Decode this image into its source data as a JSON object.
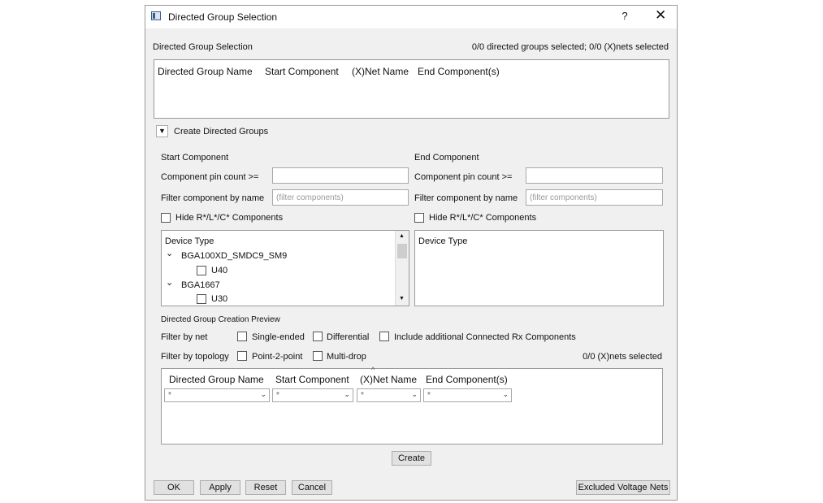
{
  "window": {
    "title": "Directed Group Selection",
    "help": "?",
    "close": "✕"
  },
  "selection": {
    "section_label": "Directed Group Selection",
    "status": "0/0 directed groups selected; 0/0 (X)nets selected",
    "columns": [
      "Directed Group Name",
      "Start Component",
      "(X)Net Name",
      "End Component(s)"
    ]
  },
  "create_section": {
    "toggle_glyph": "▼",
    "label": "Create Directed Groups"
  },
  "start": {
    "heading": "Start Component",
    "pin_count_label": "Component pin count >=",
    "pin_count_value": "",
    "filter_label": "Filter component by name",
    "filter_placeholder": "(filter components)",
    "hide_label": "Hide R*/L*/C* Components",
    "device_header": "Device Type",
    "tree": [
      {
        "label": "BGA100XD_SMDC9_SM9",
        "expander": "⌄",
        "child": "U40"
      },
      {
        "label": "BGA1667",
        "expander": "⌄",
        "child": "U30"
      }
    ],
    "scroll_up": "▲",
    "scroll_down": "▼"
  },
  "end": {
    "heading": "End Component",
    "pin_count_label": "Component pin count >=",
    "pin_count_value": "",
    "filter_label": "Filter component by name",
    "filter_placeholder": "(filter components)",
    "hide_label": "Hide R*/L*/C* Components",
    "device_header": "Device Type"
  },
  "preview": {
    "heading": "Directed Group Creation Preview",
    "filter_net_label": "Filter by net",
    "single_ended": "Single-ended",
    "differential": "Differential",
    "include_rx": "Include additional Connected Rx Components",
    "filter_topology_label": "Filter by topology",
    "point2point": "Point-2-point",
    "multidrop": "Multi-drop",
    "status": "0/0 (X)nets selected",
    "sort_indicator": "^",
    "columns": [
      "Directed Group Name",
      "Start Component",
      "(X)Net Name",
      "End Component(s)"
    ],
    "combo_value": "*",
    "combo_chevron": "⌄"
  },
  "buttons": {
    "create": "Create",
    "ok": "OK",
    "apply": "Apply",
    "reset": "Reset",
    "cancel": "Cancel",
    "excluded": "Excluded Voltage Nets"
  }
}
